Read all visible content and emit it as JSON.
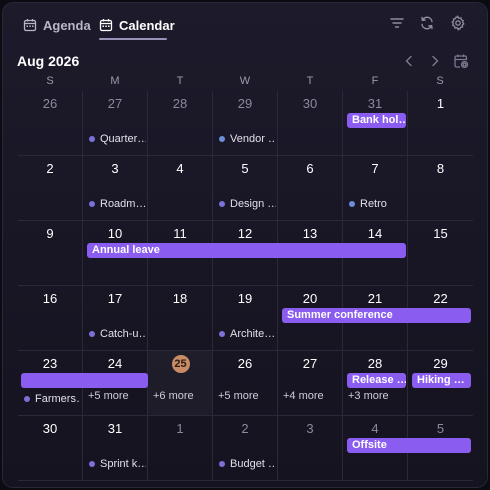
{
  "tabs": [
    {
      "label": "Agenda",
      "active": false
    },
    {
      "label": "Calendar",
      "active": true
    }
  ],
  "month_title": "Aug 2026",
  "weekdays": [
    "S",
    "M",
    "T",
    "W",
    "T",
    "F",
    "S"
  ],
  "today": "25",
  "weeks": [
    {
      "days": [
        {
          "n": "26",
          "muted": true
        },
        {
          "n": "27",
          "muted": true
        },
        {
          "n": "28",
          "muted": true
        },
        {
          "n": "29",
          "muted": true
        },
        {
          "n": "30",
          "muted": true
        },
        {
          "n": "31",
          "muted": true
        },
        {
          "n": "1"
        }
      ]
    },
    {
      "days": [
        {
          "n": "2"
        },
        {
          "n": "3"
        },
        {
          "n": "4"
        },
        {
          "n": "5"
        },
        {
          "n": "6"
        },
        {
          "n": "7"
        },
        {
          "n": "8"
        }
      ]
    },
    {
      "days": [
        {
          "n": "9"
        },
        {
          "n": "10"
        },
        {
          "n": "11"
        },
        {
          "n": "12"
        },
        {
          "n": "13"
        },
        {
          "n": "14"
        },
        {
          "n": "15"
        }
      ]
    },
    {
      "days": [
        {
          "n": "16"
        },
        {
          "n": "17"
        },
        {
          "n": "18"
        },
        {
          "n": "19"
        },
        {
          "n": "20"
        },
        {
          "n": "21"
        },
        {
          "n": "22"
        }
      ]
    },
    {
      "days": [
        {
          "n": "23"
        },
        {
          "n": "24"
        },
        {
          "n": "25",
          "today": true
        },
        {
          "n": "26"
        },
        {
          "n": "27"
        },
        {
          "n": "28"
        },
        {
          "n": "29"
        }
      ]
    },
    {
      "days": [
        {
          "n": "30"
        },
        {
          "n": "31"
        },
        {
          "n": "1",
          "muted": true
        },
        {
          "n": "2",
          "muted": true
        },
        {
          "n": "3",
          "muted": true
        },
        {
          "n": "4",
          "muted": true
        },
        {
          "n": "5",
          "muted": true
        }
      ]
    }
  ],
  "bars": [
    {
      "label": "Bank hol…",
      "week": 0,
      "start": 5,
      "span": 1
    },
    {
      "label": "Annual leave",
      "week": 2,
      "start": 1,
      "span": 5
    },
    {
      "label": "Summer conference",
      "week": 3,
      "start": 4,
      "span": 3
    },
    {
      "label": "",
      "week": 4,
      "start": 0,
      "span": 2
    },
    {
      "label": "Release …",
      "week": 4,
      "start": 5,
      "span": 1
    },
    {
      "label": "Hiking …",
      "week": 4,
      "start": 6,
      "span": 1
    },
    {
      "label": "Offsite",
      "week": 5,
      "start": 5,
      "span": 2
    }
  ],
  "dot_events": [
    {
      "label": "Quarter…",
      "week": 0,
      "day": 1,
      "color": "purple"
    },
    {
      "label": "Vendor …",
      "week": 0,
      "day": 3,
      "color": "blue"
    },
    {
      "label": "Roadm…",
      "week": 1,
      "day": 1,
      "color": "purple"
    },
    {
      "label": "Design …",
      "week": 1,
      "day": 3,
      "color": "purple"
    },
    {
      "label": "Retro",
      "week": 1,
      "day": 5,
      "color": "blue"
    },
    {
      "label": "Catch-u…",
      "week": 3,
      "day": 1,
      "color": "purple"
    },
    {
      "label": "Archite…",
      "week": 3,
      "day": 3,
      "color": "purple"
    },
    {
      "label": "Farmers…",
      "week": 4,
      "day": 0,
      "color": "purple"
    },
    {
      "label": "Sprint k…",
      "week": 5,
      "day": 1,
      "color": "purple"
    },
    {
      "label": "Budget …",
      "week": 5,
      "day": 3,
      "color": "purple"
    }
  ],
  "more_labels": [
    {
      "label": "+5 more",
      "week": 4,
      "day": 1
    },
    {
      "label": "+6 more",
      "week": 4,
      "day": 2
    },
    {
      "label": "+5 more",
      "week": 4,
      "day": 3
    },
    {
      "label": "+4 more",
      "week": 4,
      "day": 4
    },
    {
      "label": "+3 more",
      "week": 4,
      "day": 5
    }
  ]
}
